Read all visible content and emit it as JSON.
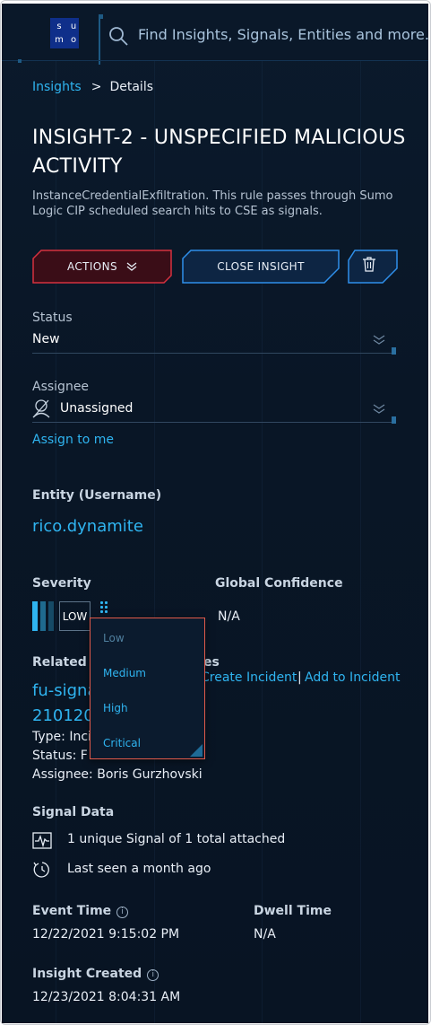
{
  "header": {
    "logo_letters": [
      "s",
      "u",
      "m",
      "o"
    ],
    "search_placeholder": "Find Insights, Signals, Entities and more..."
  },
  "breadcrumb": {
    "parent": "Insights",
    "separator": ">",
    "current": "Details"
  },
  "insight": {
    "title": "INSIGHT-2 - UNSPECIFIED MALICIOUS ACTIVITY",
    "description": "InstanceCredentialExfiltration. This rule passes through Sumo Logic CIP scheduled search hits to CSE as signals."
  },
  "buttons": {
    "actions": "ACTIONS",
    "close_insight": "CLOSE INSIGHT"
  },
  "status": {
    "label": "Status",
    "value": "New"
  },
  "assignee": {
    "label": "Assignee",
    "value": "Unassigned",
    "assign_link": "Assign to me"
  },
  "entity": {
    "label": "Entity (Username)",
    "value": "rico.dynamite"
  },
  "severity": {
    "label": "Severity",
    "value": "LOW",
    "level_fraction": 0.25
  },
  "global_confidence": {
    "label": "Global Confidence",
    "value": "N/A"
  },
  "severity_dropdown": {
    "options": [
      "Low",
      "Medium",
      "High",
      "Critical"
    ],
    "selected": "Low"
  },
  "related": {
    "label_start": "Related I",
    "label_end": "es",
    "create_link": "Create Incident",
    "separator": "|",
    "add_link": "Add to Incident",
    "link_line1": "fu-signa",
    "link_line2": "210120",
    "type_key": "Type:",
    "type_val": "Inci",
    "status_key": "Status:",
    "status_val": "F",
    "assignee_key": "Assignee:",
    "assignee_val": "Boris Gurzhovski"
  },
  "signal_data": {
    "label": "Signal Data",
    "signals_text": "1 unique Signal of 1 total attached",
    "last_seen_text": "Last seen a month ago"
  },
  "event_time": {
    "label": "Event Time",
    "info": "i",
    "value": "12/22/2021 9:15:02 PM"
  },
  "dwell_time": {
    "label": "Dwell Time",
    "value": "N/A"
  },
  "insight_created": {
    "label": "Insight Created",
    "info": "i",
    "value": "12/23/2021 8:04:31 AM"
  },
  "colors": {
    "background": "#0a1829",
    "accent_link": "#2fb4f0",
    "actions_border": "#d6313f",
    "close_border": "#2f8fea",
    "dropdown_border": "#e25a4a"
  }
}
